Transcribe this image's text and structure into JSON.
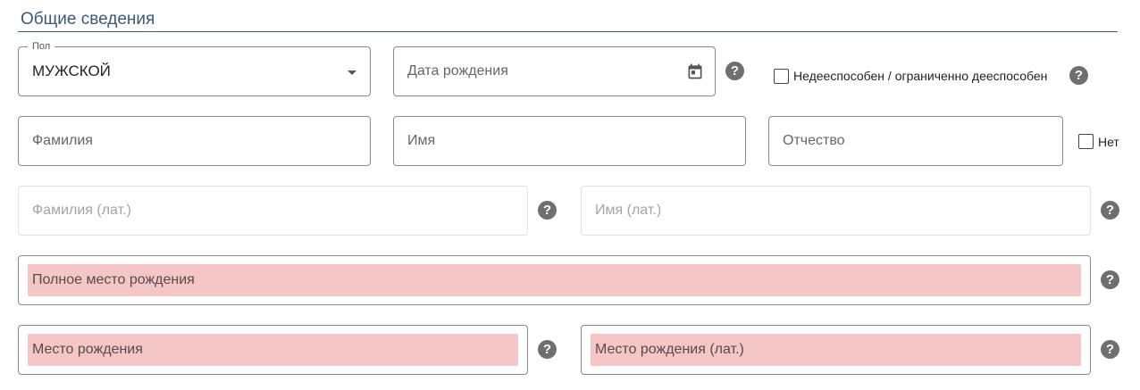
{
  "section": {
    "title": "Общие сведения"
  },
  "gender": {
    "legend": "Пол",
    "value": "МУЖСКОЙ"
  },
  "birth_date": {
    "placeholder": "Дата рождения"
  },
  "incapacity": {
    "label": "Недееспособен / ограниченно дееспособен",
    "checked": false
  },
  "surname": {
    "placeholder": "Фамилия"
  },
  "name": {
    "placeholder": "Имя"
  },
  "patronymic": {
    "placeholder": "Отчество"
  },
  "no_patronymic": {
    "label": "Нет",
    "checked": false
  },
  "surname_lat": {
    "placeholder": "Фамилия (лат.)"
  },
  "name_lat": {
    "placeholder": "Имя (лат.)"
  },
  "full_birthplace": {
    "placeholder": "Полное место рождения"
  },
  "birthplace": {
    "placeholder": "Место рождения"
  },
  "birthplace_lat": {
    "placeholder": "Место рождения (лат.)"
  },
  "help": {
    "glyph": "?"
  },
  "colors": {
    "accent": "#3a5a78",
    "error_fill": "#f5c6c6",
    "help_icon": "#6f6f6f"
  }
}
